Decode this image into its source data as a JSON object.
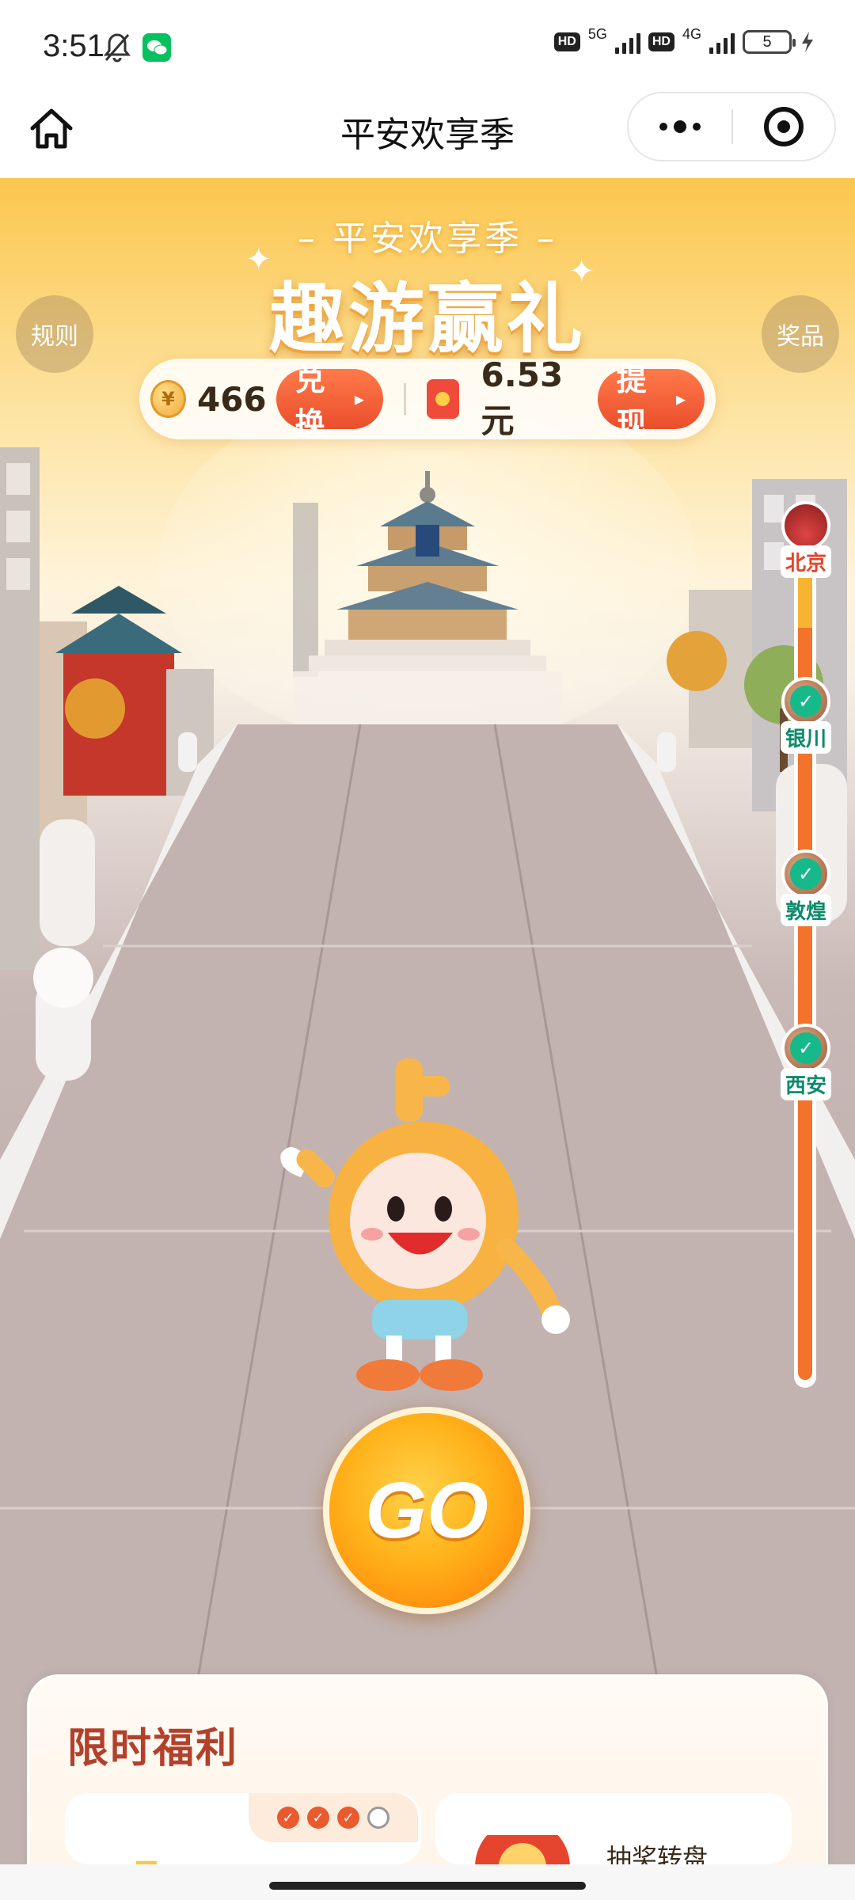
{
  "status_bar": {
    "time": "3:51",
    "hd1": "HD",
    "net1": "5G",
    "hd2": "HD",
    "net2": "4G",
    "battery": "5"
  },
  "nav": {
    "title": "平安欢享季",
    "home_icon": "home-icon",
    "more_icon": "more-icon",
    "close_icon": "target-close-icon"
  },
  "banner": {
    "subtitle": "– 平安欢享季 –",
    "title": "趣游赢礼"
  },
  "side_buttons": {
    "rules": "规则",
    "prizes": "奖品"
  },
  "currency": {
    "coins": "466",
    "exchange_label": "兑换",
    "cash": "6.53元",
    "withdraw_label": "提现"
  },
  "route": {
    "stops": [
      {
        "name": "北京",
        "status": "current"
      },
      {
        "name": "银川",
        "status": "done"
      },
      {
        "name": "敦煌",
        "status": "done"
      },
      {
        "name": "西安",
        "status": "done"
      }
    ]
  },
  "go_button": "GO",
  "benefits": {
    "title": "限时福利",
    "progress": {
      "completed": 3,
      "total": 4
    },
    "wheel_label": "抽奖转盘"
  },
  "colors": {
    "accent": "#ea4e2c",
    "route_done": "#17b98a",
    "sky": "#fbc64e"
  }
}
